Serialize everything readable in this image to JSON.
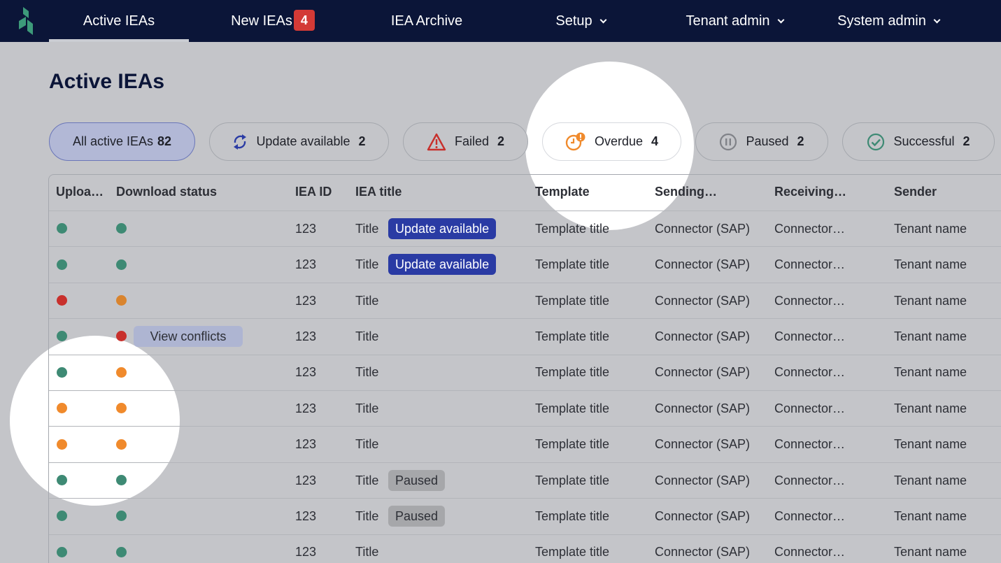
{
  "nav": {
    "items": [
      {
        "label": "Active IEAs"
      },
      {
        "label": "New IEAs",
        "badge": "4"
      },
      {
        "label": "IEA Archive"
      },
      {
        "label": "Setup"
      },
      {
        "label": "Tenant admin"
      },
      {
        "label": "System admin"
      }
    ]
  },
  "page": {
    "title": "Active IEAs"
  },
  "filters": [
    {
      "label": "All active IEAs",
      "count": "82"
    },
    {
      "label": "Update available",
      "count": "2",
      "icon": "refresh-icon"
    },
    {
      "label": "Failed",
      "count": "2",
      "icon": "warning-triangle-icon"
    },
    {
      "label": "Overdue",
      "count": "4",
      "icon": "clock-alert-icon"
    },
    {
      "label": "Paused",
      "count": "2",
      "icon": "pause-circle-icon"
    },
    {
      "label": "Successful",
      "count": "2",
      "icon": "check-circle-icon"
    }
  ],
  "table": {
    "columns": [
      "Uploa…",
      "Download status",
      "IEA ID",
      "IEA title",
      "Template",
      "Sending…",
      "Receiving…",
      "Sender"
    ],
    "rows": [
      {
        "upload": "green",
        "download": "green",
        "id": "123",
        "title": "Title",
        "tag": "Update available",
        "template": "Template title",
        "sending": "Connector (SAP)",
        "receiving": "Connector…",
        "sender": "Tenant name"
      },
      {
        "upload": "green",
        "download": "green",
        "id": "123",
        "title": "Title",
        "tag": "Update available",
        "template": "Template title",
        "sending": "Connector (SAP)",
        "receiving": "Connector…",
        "sender": "Tenant name"
      },
      {
        "upload": "red",
        "download": "orange-dim",
        "id": "123",
        "title": "Title",
        "template": "Template title",
        "sending": "Connector (SAP)",
        "receiving": "Connector…",
        "sender": "Tenant name"
      },
      {
        "upload": "green",
        "download": "red",
        "download_action": "View conflicts",
        "id": "123",
        "title": "Title",
        "template": "Template title",
        "sending": "Connector (SAP)",
        "receiving": "Connector…",
        "sender": "Tenant name"
      },
      {
        "upload": "green",
        "download": "orange",
        "id": "123",
        "title": "Title",
        "template": "Template title",
        "sending": "Connector (SAP)",
        "receiving": "Connector…",
        "sender": "Tenant name"
      },
      {
        "upload": "orange",
        "download": "orange",
        "id": "123",
        "title": "Title",
        "template": "Template title",
        "sending": "Connector (SAP)",
        "receiving": "Connector…",
        "sender": "Tenant name"
      },
      {
        "upload": "orange",
        "download": "orange",
        "id": "123",
        "title": "Title",
        "template": "Template title",
        "sending": "Connector (SAP)",
        "receiving": "Connector…",
        "sender": "Tenant name"
      },
      {
        "upload": "green",
        "download": "green",
        "id": "123",
        "title": "Title",
        "tag": "Paused",
        "template": "Template title",
        "sending": "Connector (SAP)",
        "receiving": "Connector…",
        "sender": "Tenant name"
      },
      {
        "upload": "green",
        "download": "green",
        "id": "123",
        "title": "Title",
        "tag": "Paused",
        "template": "Template title",
        "sending": "Connector (SAP)",
        "receiving": "Connector…",
        "sender": "Tenant name"
      },
      {
        "upload": "green",
        "download": "green",
        "id": "123",
        "title": "Title",
        "template": "Template title",
        "sending": "Connector (SAP)",
        "receiving": "Connector…",
        "sender": "Tenant name"
      }
    ]
  },
  "colors": {
    "nav_bg": "#0b1538",
    "green": "#3e8a74",
    "red": "#c8302c",
    "orange": "#f08a2c",
    "accent_blue": "#2a3ba4"
  }
}
